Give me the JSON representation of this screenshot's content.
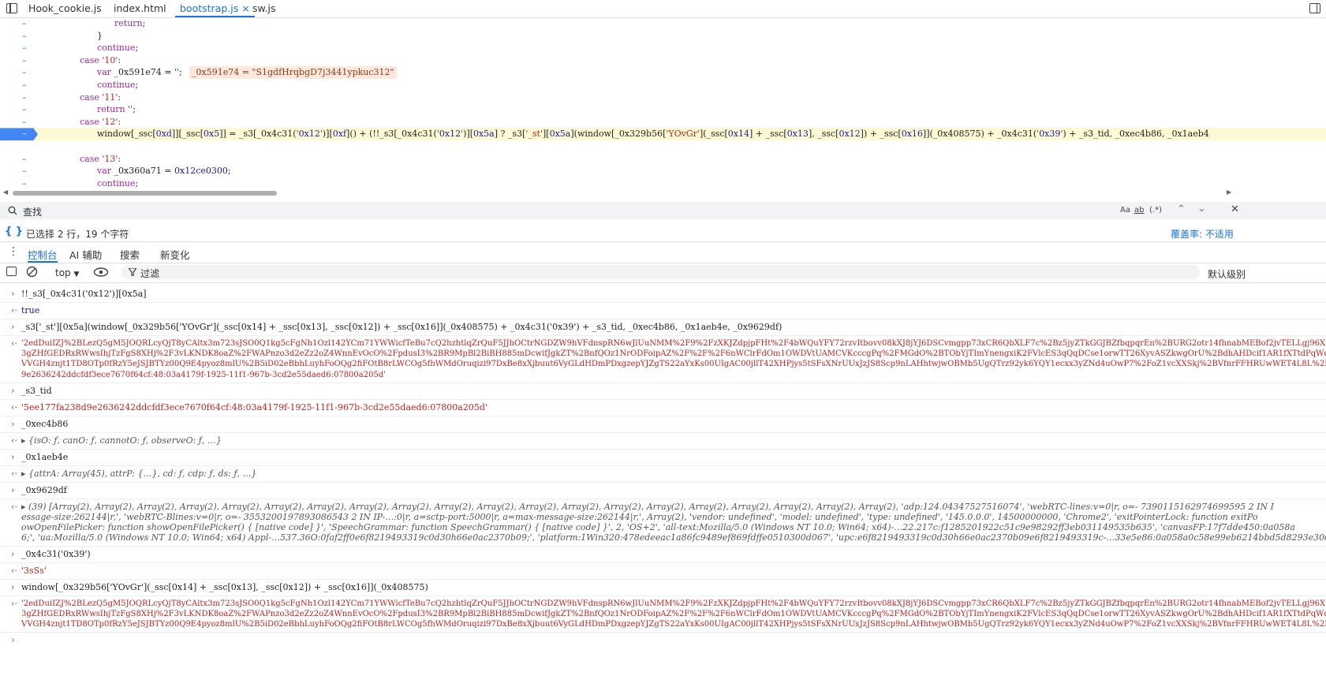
{
  "tabs": [
    "Hook_cookie.js",
    "index.html",
    "bootstrap.js",
    "sw.js"
  ],
  "tab_close": "×",
  "code_lines": [
    {
      "text": "return;"
    },
    {
      "text": "}"
    },
    {
      "text": "continue;"
    },
    {
      "text": "case '10':"
    },
    {
      "text": "var _0x591e74 = '';"
    },
    {
      "text": "_0x591e74 = \"S1gdfHrqbgD7j3441ypkuc312\""
    },
    {
      "text": "continue;"
    },
    {
      "text": "case '11':"
    },
    {
      "text": "return '';"
    },
    {
      "text": "case '12':"
    },
    {
      "text": "window[_ssc[0xd]][_ssc[0x5]] = _s3[_0x4c31('0x12')][0xf]() + (!!_s3[_0x4c31('0x12')][0x5a] ? _s3['_st'][0x5a](window[_0x329b56['YOvGr'](_ssc[0x14] + _ssc[0x13], _ssc[0x12]) + _ssc[0x16]](_0x408575) + _0x4c31('0x39') + _s3_tid, _0xec4b86, _0x1aeb4"
    },
    {
      "text": "case '13':"
    },
    {
      "text": "var _0x360a71 = 0x12ce0300;"
    },
    {
      "text": "continue;"
    }
  ],
  "gutter_mark": "–",
  "search_label": "查找",
  "search_opts": [
    "Aa",
    "ab",
    "(.*)"
  ],
  "status_text": "已选择 2 行，19 个字符",
  "coverage_text": "覆盖率: 不适用",
  "drawer_tabs": [
    "控制台",
    "AI 辅助",
    "搜索",
    "新变化"
  ],
  "context": "top",
  "filter_label": "过滤",
  "levels_label": "默认级别",
  "console": [
    {
      "type": "in",
      "text": "!!_s3[_0x4c31('0x12')][0x5a]"
    },
    {
      "type": "out",
      "text": "true",
      "cls": "bool"
    },
    {
      "type": "in",
      "text": "_s3['_st'][0x5a](window[_0x329b56['YOvGr'](_ssc[0x14] + _ssc[0x13], _ssc[0x12]) + _ssc[0x16]](_0x408575) + _0x4c31('0x39') + _s3_tid, _0xec4b86, _0x1aeb4e, _0x9629df)"
    },
    {
      "type": "out",
      "cls": "red",
      "lines": [
        "'2edDuiIZJ%2BLezQ5gM5JOQRLcyQjT8yCAltx3m723sJSO0Q1kg5cFgNh1Ozl142YCm71YWWicfTeBu7cQ2hzhtlqZrQuF5JJhOCtrNGDZW9hVFdnspRN6wJlUuNMM%2F9%2FzXKJZdpjpFHt%2F4bWQuYFY72rzvItbovv08kXJ8jYJ6DSCvmgpp73xCR6QbXLF7c%2Bz5jyZTkGGJBZfbqpqrEn%2BURG2otr14fhnabMEBof2jvTELLgj96XtaCyOFrGnL6krRTJccFWI",
        "3gZHfGEDRxRWwsIhjTzFgS8XHj%2F3vLKNDK8oaZ%2FWAPnzo3d2eZz2oZ4WnnEvOcO%2FpdusI3%2BR9MpBl2BiBH885mDcwifJgkZT%2BnfQOz1NrODFoipAZ%2F%2F%2F6nWClrFdOm1OWDVtUAMCVKcccgPq%2FMGdO%2BTObYjTImYnengxiK2FVlcES3qQqDCse1orwTT26XyvASZkwgOrU%2BdhAHDcif1AR1fXTtdPqWdKEcF%2BmqL%2BahMh2W1VXz1szfBLE1",
        "VVGH4znjt1TD8OTp0fRzY5eJSJBTYz00Q9E4pyoz8mlU%2B5iD02eBbhLuyhFoOQg2fiFOtB8rLWCOg5fhWMdOruqizi97DxBe8xXjbuut6VyGLdHDmPDxgzepYJZgTS22aYxKs00UIgAC00jllT42XHPjys5tSFsXNrUUxJzJS8Scp9nLAHhtwjwOBMb5UgQTrz92yk6YQY1ecxx3yZNd4uOwP7%2FoZ1vcXXSkj%2BVfnrFFHRUwWET4L8L%2FF%2F51yJRD2S1PYQtS9",
        "9e2636242ddcfdf3ece7670f64cf:48:03a4179f-1925-11f1-967b-3cd2e55daed6:07800a205d'"
      ]
    },
    {
      "type": "in",
      "text": "_s3_tid"
    },
    {
      "type": "out",
      "cls": "red",
      "text": "'5ee177fa238d9e2636242ddcfdf3ece7670f64cf:48:03a4179f-1925-11f1-967b-3cd2e55daed6:07800a205d'"
    },
    {
      "type": "in",
      "text": "_0xec4b86"
    },
    {
      "type": "out",
      "cls": "obj",
      "text": "▸ {isO: ƒ, canO: ƒ, cannotO: ƒ, observeO: ƒ, …}"
    },
    {
      "type": "in",
      "text": "_0x1aeb4e"
    },
    {
      "type": "out",
      "cls": "obj",
      "text": "▸ {attrA: Array(45), attrP: {…}, cd: ƒ, cdp: ƒ, ds: ƒ, …}"
    },
    {
      "type": "in",
      "text": "_0x9629df"
    },
    {
      "type": "out",
      "cls": "obj",
      "lines": [
        "▸ (39) [Array(2), Array(2), Array(2), Array(2), Array(2), Array(2), Array(2), Array(2), Array(2), Array(2), Array(2), Array(2), Array(2), Array(2), Array(2), Array(2), Array(2), Array(2), Array(2), Array(2), 'adp:124.04347527516074', 'webRTC-lines:v=0|r, o=- 7390115162974699595 2 IN I",
        "essage-size:262144|r,', 'webRTC-Blines:v=0|r, o=- 3553200197893086543 2 IN IP-…:0|r, a=sctp-port:5000|r, a=max-message-size:262144|r,', Array(2), 'vendor: undefined', 'model: undefined', 'type: undefined', '145.0.0.0', 14500000000, 'Chrome2', 'exitPointerLock: function exitPo",
        "owOpenFilePicker: function showOpenFilePicker() { [native code] }', 'SpeechGrammar: function SpeechGrammar() { [native code] }', 2, 'OS+2', 'all-text:Mozilla/5.0 (Windows NT 10.0; Win64; x64)-…22.217c:f1285201922c51c9e98292ff3eb031149535b635', 'canvasFP:17f7dde450:0a058a",
        "6;', 'ua:Mozilla/5.0 (Windows NT 10.0; Win64; x64) Appl-…537.36O:0faf2ff0e6f8219493319c0d30h66e0ac2370b09;', 'platform:1Win320:478edeeac1a86fc9489ef869fdffe0510300d067', 'upc:e6f8219493319c0d30h66e0ac2370b09e6f8219493319c-…33e5e86:0a058a0c58e99eb6214bbd5d8293e30d633e5e86"
      ]
    },
    {
      "type": "in",
      "text": "_0x4c31('0x39')"
    },
    {
      "type": "out",
      "cls": "red",
      "text": "'3sSs'"
    },
    {
      "type": "in",
      "text": "window[_0x329b56['YOvGr'](_ssc[0x14] + _ssc[0x13], _ssc[0x12]) + _ssc[0x16]](_0x408575)"
    },
    {
      "type": "out",
      "cls": "red",
      "lines": [
        "'2edDuiIZJ%2BLezQ5gM5JOQRLcyQjT8yCAltx3m723sJSO0Q1kg5cFgNh1Ozl142YCm71YWWicfTeBu7cQ2hzhtlqZrQuF5JJhOCtrNGDZW9hVFdnspRN6wJlUuNMM%2F9%2FzXKJZdpjpFHt%2F4bWQuYFY72rzvItbovv08kXJ8jYJ6DSCvmgpp73xCR6QbXLF7c%2Bz5jyZTkGGJBZfbqpqrEn%2BURG2otr14fhnabMEBof2jvTELLgj96XtaCyOFrGnL6krRTJccFWI",
        "3gZHfGEDRxRWwsIhjTzFgS8XHj%2F3vLKNDK8oaZ%2FWAPnzo3d2eZz2oZ4WnnEvOcO%2FpdusI3%2BR9MpBl2BiBH885mDcwifJgkZT%2BnfQOz1NrODFoipAZ%2F%2F%2F6nWClrFdOm1OWDVtUAMCVKcccgPq%2FMGdO%2BTObYjTImYnengxiK2FVlcES3qQqDCse1orwTT26XyvASZkwgOrU%2BdhAHDcif1AR1fXTtdPqWdKEcF%2BmqL%2BahMh2W1VXz1szfBLE1",
        "VVGH4znjt1TD8OTp0fRzY5eJSJBTYz00Q9E4pyoz8mlU%2B5iD02eBbhLuyhFoOQg2fiFOtB8rLWCOg5fhWMdOruqizi97DxBe8xXjbuut6VyGLdHDmPDxgzepYJZgTS22aYxKs00UIgAC00jllT42XHPjys5tSFsXNrUUxJzJS8Scp9nLAHhtwjwOBMb5UgQTrz92yk6YQY1ecxx3yZNd4uOwP7%2FoZ1vcXXSkj%2BVfnrFFHRUwWET4L8L%2FF%2F51yJRD2S1PYQtS9"
      ]
    }
  ]
}
